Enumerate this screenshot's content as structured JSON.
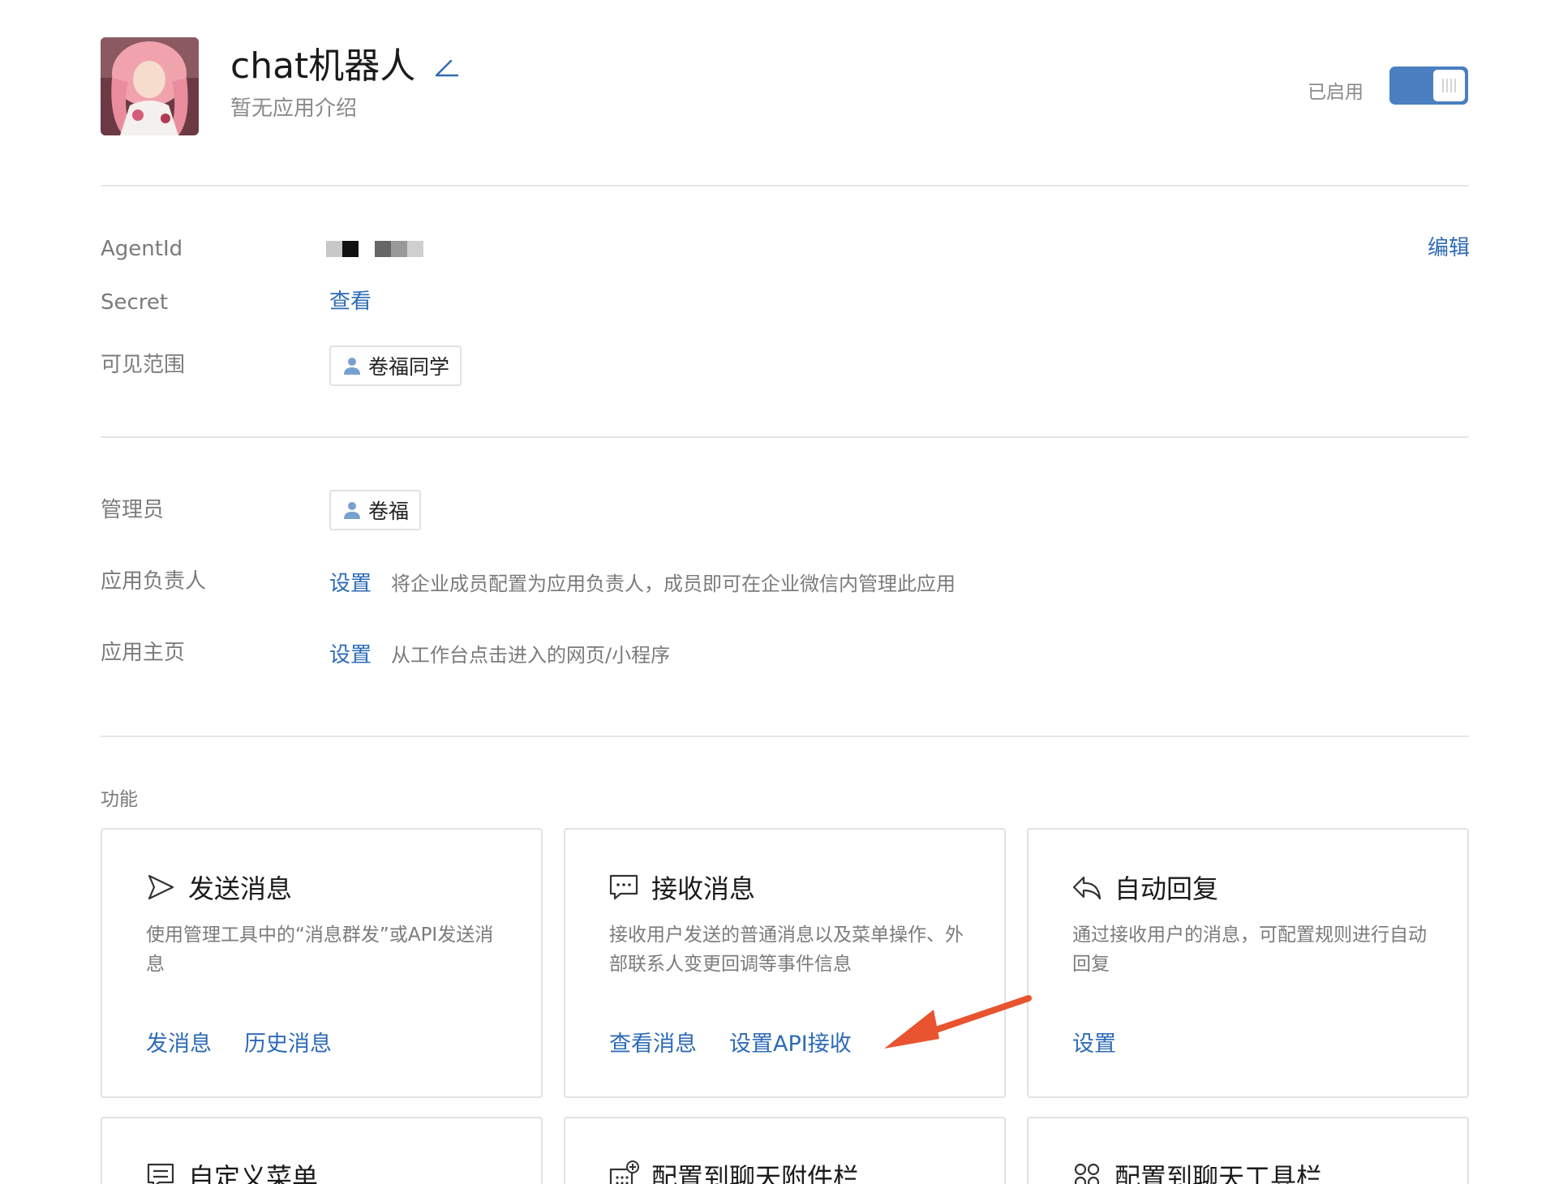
{
  "header": {
    "app_name": "chat机器人",
    "app_intro": "暂无应用介绍",
    "status_label": "已启用",
    "enabled": true
  },
  "info": {
    "agentid_label": "AgentId",
    "agentid_value_masked": true,
    "edit_label": "编辑",
    "secret_label": "Secret",
    "secret_link": "查看",
    "visibility_label": "可见范围",
    "visibility_member": "卷福同学"
  },
  "admin": {
    "admin_label": "管理员",
    "admin_member": "卷福",
    "owner_label": "应用负责人",
    "owner_link": "设置",
    "owner_desc": "将企业成员配置为应用负责人，成员即可在企业微信内管理此应用",
    "homepage_label": "应用主页",
    "homepage_link": "设置",
    "homepage_desc": "从工作台点击进入的网页/小程序"
  },
  "features": {
    "section_label": "功能",
    "cards": [
      {
        "icon": "send-icon",
        "title": "发送消息",
        "desc": "使用管理工具中的“消息群发”或API发送消息",
        "links": [
          "发消息",
          "历史消息"
        ]
      },
      {
        "icon": "chat-bubble-icon",
        "title": "接收消息",
        "desc": "接收用户发送的普通消息以及菜单操作、外部联系人变更回调等事件信息",
        "links": [
          "查看消息",
          "设置API接收"
        ]
      },
      {
        "icon": "reply-icon",
        "title": "自动回复",
        "desc": "通过接收用户的消息，可配置规则进行自动回复",
        "links": [
          "设置"
        ]
      },
      {
        "icon": "menu-icon",
        "title": "自定义菜单"
      },
      {
        "icon": "attachment-bar-icon",
        "title": "配置到聊天附件栏"
      },
      {
        "icon": "toolbar-icon",
        "title": "配置到聊天工具栏"
      }
    ]
  },
  "colors": {
    "link": "#2d6bb6",
    "toggle_on": "#4a7fc1",
    "annotation_arrow": "#e8542f"
  }
}
